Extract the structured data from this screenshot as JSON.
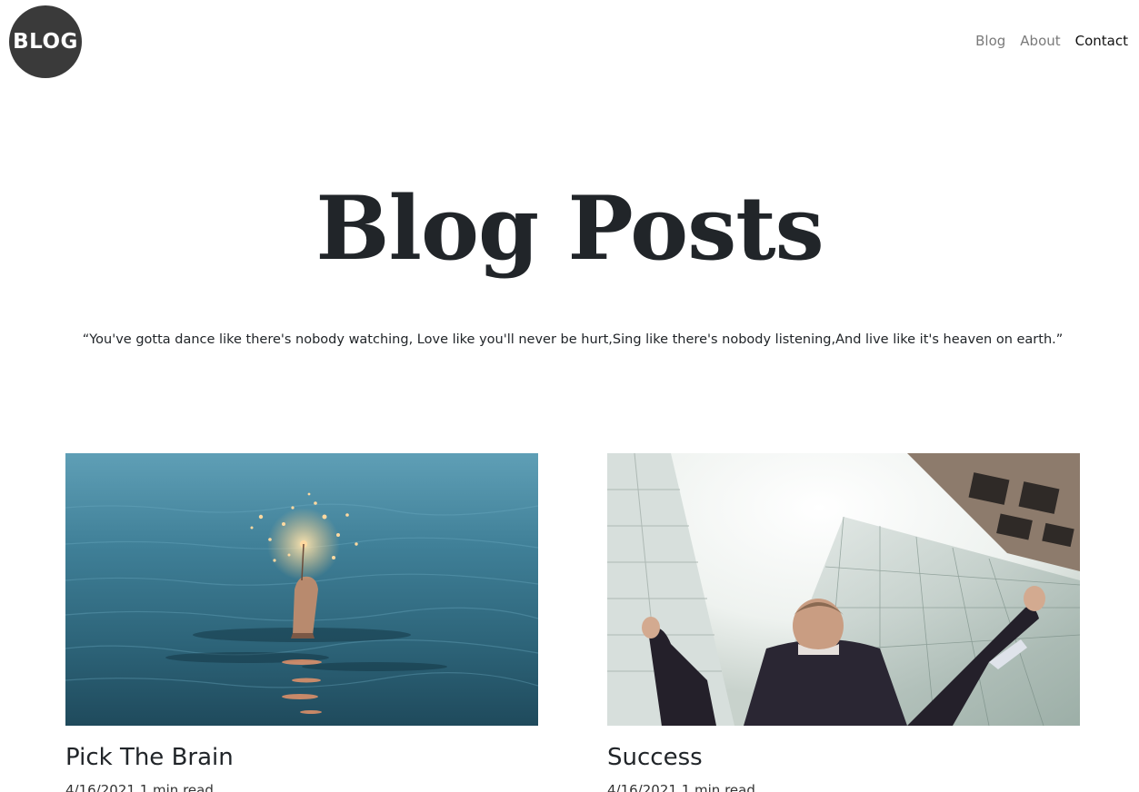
{
  "header": {
    "logo_text": "BLOG",
    "nav": [
      {
        "label": "Blog"
      },
      {
        "label": "About"
      },
      {
        "label": "Contact"
      }
    ]
  },
  "hero": {
    "title": "Blog Posts",
    "quote": "“You've gotta dance like there's nobody watching, Love like you'll never be hurt,Sing like there's nobody listening,And live like it's heaven on earth.”"
  },
  "posts": [
    {
      "title": "Pick The Brain",
      "date": "4/16/2021",
      "read_time": "1 min read",
      "image": "sparkler-in-sea-photo"
    },
    {
      "title": "Success",
      "date": "4/16/2021",
      "read_time": "1 min read",
      "image": "businessman-arms-raised-skyscrapers-photo"
    }
  ],
  "colors": {
    "logo_bg": "#3a3a3a",
    "nav_inactive": "#7a7a7a",
    "nav_active": "#111111",
    "text": "#212529"
  }
}
